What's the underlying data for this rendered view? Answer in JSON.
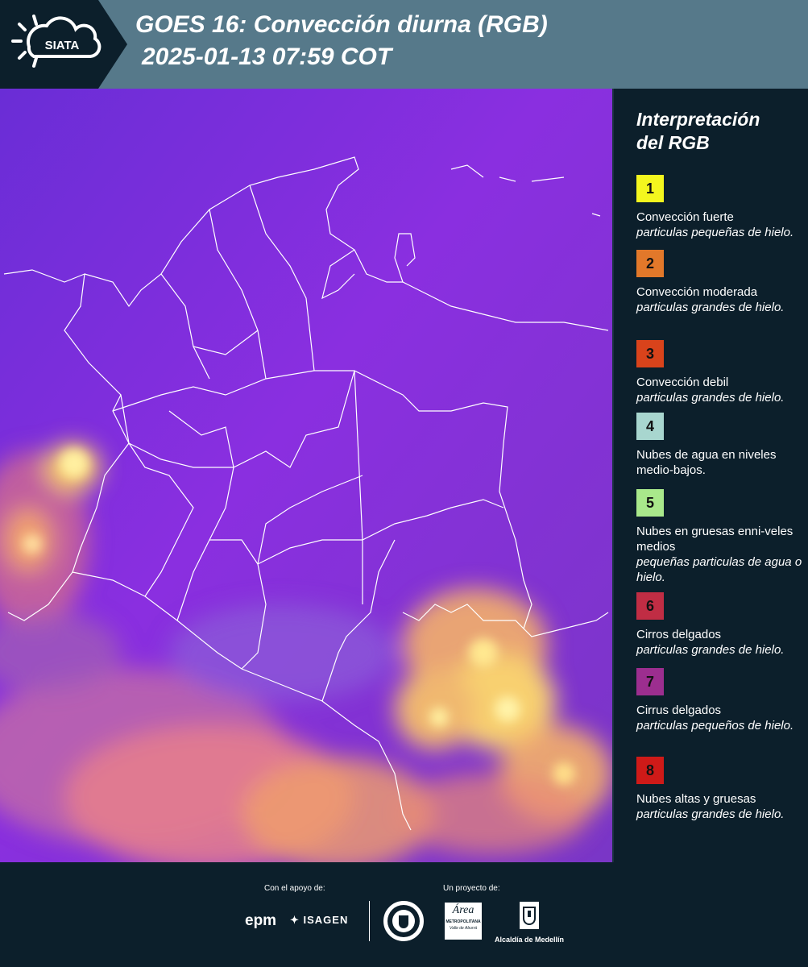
{
  "header": {
    "title_line1": "GOES 16: Convección diurna (RGB)",
    "title_line2": "2025-01-13 07:59 COT",
    "logo_text": "SIATA"
  },
  "legend": {
    "title_line1": "Interpretación",
    "title_line2": "del RGB",
    "items": [
      {
        "num": "1",
        "color": "#f4f61e",
        "label": "Convección fuerte",
        "sub": "particulas pequeñas de hielo."
      },
      {
        "num": "2",
        "color": "#e2782a",
        "label": "Convección moderada",
        "sub": "particulas grandes de hielo."
      },
      {
        "num": "3",
        "color": "#d9431b",
        "label": "Convección debil",
        "sub": "particulas grandes de hielo."
      },
      {
        "num": "4",
        "color": "#a8d6cf",
        "label": "Nubes de agua en niveles medio-bajos.",
        "sub": ""
      },
      {
        "num": "5",
        "color": "#a9e88b",
        "label": "Nubes en gruesas enni-veles medios",
        "sub": "pequeñas particulas de agua o hielo."
      },
      {
        "num": "6",
        "color": "#c02d44",
        "label": "Cirros delgados",
        "sub": "particulas grandes de hielo."
      },
      {
        "num": "7",
        "color": "#9c2e8f",
        "label": "Cirrus delgados",
        "sub": "particulas pequeños de hielo."
      },
      {
        "num": "8",
        "color": "#cf1a18",
        "label": "Nubes altas y gruesas",
        "sub": "particulas grandes de hielo."
      }
    ]
  },
  "footer": {
    "support_label": "Con el apoyo de:",
    "project_label": "Un proyecto de:",
    "epm": "epm",
    "isagen": "ISAGEN",
    "area_line1": "Área",
    "area_line2": "METROPOLITANA",
    "area_line3": "Valle de Aburrá",
    "alcaldia": "Alcaldía de Medellín"
  },
  "colors": {
    "background": "#0c1f2b",
    "header": "#56798a",
    "map_base": "#7b2ed2"
  }
}
